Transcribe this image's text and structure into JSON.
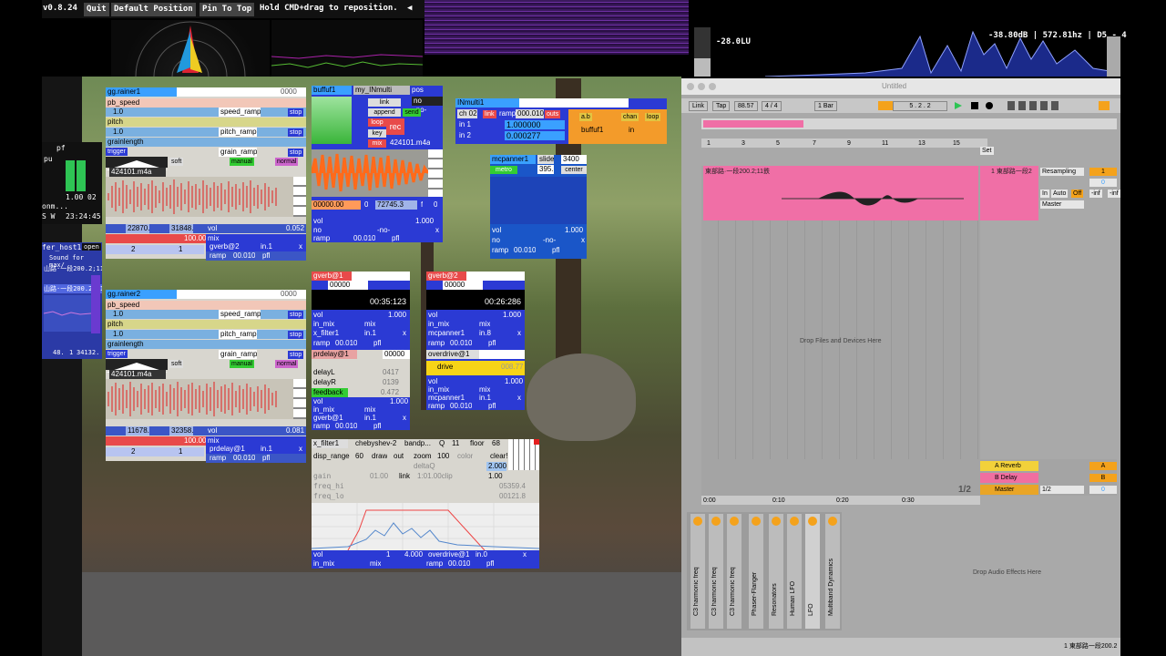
{
  "top_bar": {
    "version": "v0.8.24",
    "quit": "Quit",
    "default_position": "Default Position",
    "pin_to_top": "Pin To Top",
    "hint": "Hold CMD+drag to reposition.",
    "arrow": "◀"
  },
  "meters": {
    "lufs": "-28.0LU",
    "spectrum_readout": "-38.80dB | 572.81hz | D5 - 4"
  },
  "left_meter": {
    "a": "pf",
    "b": "pu",
    "c": "1.00",
    "d": "02",
    "time": "23:24:45",
    "e": "S W",
    "f": "onm..."
  },
  "buffer_host": {
    "title": "fer_host1",
    "open": "open",
    "sound": "Sound for max/",
    "file1": "山路·一段200.2;11...",
    "file2": "山路·一段200.2;11",
    "n1": "48.",
    "n2": "1",
    "n3": "34132."
  },
  "granular1": {
    "title": "gg.rainer1",
    "value": "0000",
    "pb_speed": "pb_speed",
    "pitch": "pitch",
    "grainlength": "grainlength",
    "speed_ramp": "speed_ramp",
    "pitch_ramp": "pitch_ramp",
    "grain_ramp": "grain_ramp",
    "stop": "stop",
    "v1": "1.0",
    "v2": "1.0",
    "trigger": "trigger",
    "soft": "soft",
    "manual": "manual",
    "normal": "normal",
    "file": "424101.m4a",
    "start": "22870.",
    "length": "31848.",
    "stretch": "100.00",
    "vol": "vol",
    "mix": "mix",
    "gverb": "gverb@2",
    "in1": "in.1",
    "vol_val": "0.052",
    "x": "x",
    "p_val": "2",
    "ramp": "ramp",
    "ramp_val": "00.010",
    "pfl": "pfl",
    "one": "1"
  },
  "granular2": {
    "title": "gg.rainer2",
    "value": "0000",
    "pb_speed": "pb_speed",
    "pitch": "pitch",
    "grainlength": "grainlength",
    "speed_ramp": "speed_ramp",
    "pitch_ramp": "pitch_ramp",
    "grain_ramp": "grain_ramp",
    "stop": "stop",
    "v1": "1.0",
    "v2": "1.0",
    "trigger": "trigger",
    "soft": "soft",
    "manual": "manual",
    "normal": "normal",
    "file": "424101.m4a",
    "start": "11678.",
    "length": "32358.",
    "stretch": "100.00",
    "vol": "vol",
    "mix": "mix",
    "dest": "prdelay@1",
    "in1": "in.1",
    "vol_val": "0.081",
    "x": "x",
    "p_val": "2",
    "ramp": "ramp",
    "ramp_val": "00.010",
    "pfl": "pfl",
    "one": "1"
  },
  "buffuf": {
    "title": "buffuf1",
    "name": "my_INmulti",
    "pos": "pos",
    "no": "no",
    "no2": "-no-",
    "link": "link",
    "append": "append",
    "send": "send",
    "loop": "loop",
    "rec": "rec",
    "key": "key",
    "mix": "mix",
    "file": "424101.m4a",
    "time": "00000.00",
    "zero": "0",
    "length": "72745.3",
    "f": "f",
    "vol": "vol",
    "no3": "no",
    "no4": "-no-",
    "ramp": "ramp",
    "ramp_val": "00.010",
    "pfl": "pfl",
    "x": "x",
    "vol_val": "1.000",
    "zero2": "0"
  },
  "inmulti": {
    "title": "INmulti1",
    "ch": "ch 02",
    "link": "link",
    "ramp": "ramp",
    "ramp_val": "000.010",
    "outs": "outs",
    "in1": "in 1",
    "in2": "in 2",
    "v1": "1.000000",
    "v2": "0.000277",
    "ab": "a.b",
    "chan": "chan",
    "loop": "loop",
    "buffuf": "buffuf1",
    "in": "in"
  },
  "mcpanner": {
    "title": "mcpanner1",
    "slide": "slide",
    "slide_val": "3400",
    "metro": "metro",
    "metro_val": "395.",
    "center": "center",
    "vol": "vol",
    "vol_val": "1.000",
    "no": "no",
    "no2": "-no-",
    "ramp": "ramp",
    "ramp_val": "00.010",
    "pfl": "pfl",
    "x": "x"
  },
  "gverb1": {
    "title": "gverb@1",
    "num": "00000",
    "time": "00:35:123",
    "vol": "vol",
    "vol_val": "1.000",
    "in_mix": "in_mix",
    "mix": "mix",
    "dest": "x_filter1",
    "in1": "in.1",
    "ramp": "ramp",
    "ramp_val": "00.010",
    "pfl": "pfl",
    "x": "x"
  },
  "gverb2": {
    "title": "gverb@2",
    "num": "00000",
    "time": "00:26:286",
    "vol": "vol",
    "vol_val": "1.000",
    "in_mix": "in_mix",
    "mix": "mix",
    "dest": "mcpanner1",
    "in8": "in.8",
    "ramp": "ramp",
    "ramp_val": "00.010",
    "pfl": "pfl",
    "x": "x"
  },
  "prdelay": {
    "title": "prdelay@1",
    "num": "00000",
    "delayL": "delayL",
    "delayR": "delayR",
    "feedback": "feedback",
    "dl": "0417",
    "dr": "0139",
    "fb": "0.472",
    "vol": "vol",
    "vol_val": "1.000",
    "in_mix": "in_mix",
    "mix": "mix",
    "dest": "gverb@1",
    "in1": "in.1",
    "ramp": "ramp",
    "ramp_val": "00.010",
    "pfl": "pfl",
    "x": "x"
  },
  "overdrive": {
    "title": "overdrive@1",
    "drive": "drive",
    "drive_val": "008.77",
    "vol": "vol",
    "vol_val": "1.000",
    "in_mix": "in_mix",
    "mix": "mix",
    "dest": "mcpanner1",
    "in1": "in.1",
    "ramp": "ramp",
    "ramp_val": "00.010",
    "pfl": "pfl",
    "x": "x"
  },
  "xfilter": {
    "title": "x_filter1",
    "type": "chebyshev-2",
    "band": "bandp...",
    "q": "Q",
    "q_val": "11",
    "floor": "floor",
    "floor_val": "68",
    "disp_range": "disp_range",
    "dr_val": "60",
    "draw": "draw",
    "out": "out",
    "zoom": "zoom",
    "zoom_val": "100",
    "color": "color",
    "clear": "clear!",
    "deltaq": "deltaQ",
    "dq_val": "2.000",
    "gain": "gain",
    "gain_val": "01.00",
    "link": "link",
    "clip": "1:01.00clip",
    "clip_val": "1.00",
    "freq_hi": "freq_hi",
    "fh_val": "05359.4",
    "freq_lo": "freq_lo",
    "fl_val": "00121.8",
    "vol": "vol",
    "one": "1",
    "vol_val": "4.000",
    "dest": "overdrive@1",
    "in0": "in.0",
    "x": "x",
    "in_mix": "in_mix",
    "mix": "mix",
    "ramp": "ramp",
    "ramp_val": "00.010",
    "pfl": "pfl"
  },
  "live": {
    "title": "Untitled",
    "link": "Link",
    "tap": "Tap",
    "tempo": "88.57",
    "sig": "4 / 4",
    "bar": "1 Bar",
    "position": "5 .   2 .   2",
    "ruler": [
      "1",
      "3",
      "5",
      "7",
      "9",
      "11",
      "13",
      "15"
    ],
    "set": "Set",
    "clip_name": "東部路·一段200.2;11鉄",
    "track_name": "1 東部路一段2",
    "resampling": "Resampling",
    "no_input": "",
    "in": "In",
    "auto": "Auto",
    "off": "Off",
    "master": "Master",
    "inf1": "-inf",
    "inf2": "-inf",
    "zero": "0",
    "one": "1",
    "drop_files": "Drop Files and Devices Here",
    "returns": [
      {
        "name": "A Reverb",
        "letter": "A",
        "color": "#f2d13a"
      },
      {
        "name": "B Delay",
        "letter": "B",
        "color": "#f06fa0"
      },
      {
        "name": "Master",
        "letter": "0",
        "color": "#e9a526"
      }
    ],
    "page": "1/2",
    "master_io": "1/2",
    "time_markers": [
      "0:00",
      "0:10",
      "0:20",
      "0:30"
    ],
    "devices": [
      "C3 harmonic freq",
      "C3 harmonic freq",
      "C3 harmonic freq",
      "Phaser-Flanger",
      "Resonators",
      "Human LFO",
      "LFO",
      "Multiband Dynamics"
    ],
    "drop_effects": "Drop Audio Effects Here",
    "bottom_clip": "1 東部路一段200.2"
  },
  "colors": {
    "pink": "#f06fa6",
    "orange": "#ff6a1a",
    "blue": "#2b3ad4",
    "red": "#e41e1e",
    "yellow": "#f7d417"
  }
}
